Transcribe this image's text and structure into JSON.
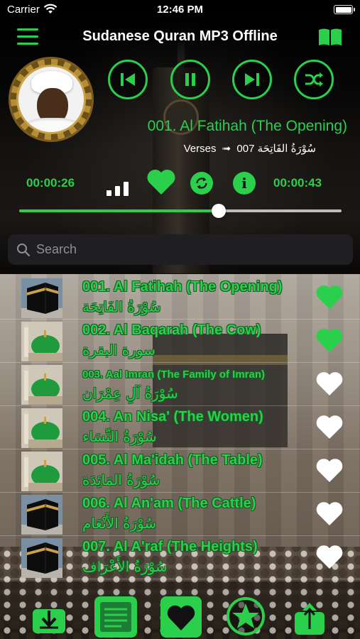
{
  "status_bar": {
    "carrier": "Carrier",
    "time": "12:46 PM"
  },
  "header": {
    "title": "Sudanese Quran MP3 Offline"
  },
  "player": {
    "track_title": "001. Al Fatihah (The Opening)",
    "verses_label": "Verses",
    "verses_count": "007",
    "arabic_name": "سُوْرَةُ الفَاتِحَة",
    "time_elapsed": "00:00:26",
    "time_total": "00:00:43",
    "progress": 0.62,
    "is_playing": true,
    "is_favorite": true
  },
  "search": {
    "placeholder": "Search"
  },
  "surahs": [
    {
      "en": "001. Al Fatihah (The Opening)",
      "ar": "سُوْرَةُ الفَاتِحَة",
      "thumb": "kaaba",
      "favorite": true
    },
    {
      "en": "002. Al Baqarah (The Cow)",
      "ar": "سورة البقرة",
      "thumb": "mosque",
      "favorite": true
    },
    {
      "en": "003. Aal Imran (The Family of Imran)",
      "ar": "سُوْرَةُ آلِ عِمْرَان",
      "thumb": "mosque",
      "favorite": false
    },
    {
      "en": "004. An Nisa' (The Women)",
      "ar": "سُوْرَةُ النِّسَاء",
      "thumb": "mosque",
      "favorite": false
    },
    {
      "en": "005. Al Ma'idah (The Table)",
      "ar": "سُوْرَةُ المَائِدَة",
      "thumb": "mosque",
      "favorite": false
    },
    {
      "en": "006. Al An'am (The Cattle)",
      "ar": "سُوْرَةُ الأَنْعَام",
      "thumb": "kaaba",
      "favorite": false
    },
    {
      "en": "007. Al A'raf (The Heights)",
      "ar": "سُوْرَةُ الأَعْرَاف",
      "thumb": "kaaba",
      "favorite": false
    }
  ],
  "colors": {
    "accent": "#2ad04c",
    "background": "#000000",
    "search_bg": "#1f1f21",
    "placeholder": "#8e8e93"
  },
  "tabs": [
    {
      "icon": "download-icon"
    },
    {
      "icon": "quran-book-icon"
    },
    {
      "icon": "favorites-heart-icon"
    },
    {
      "icon": "rate-star-icon"
    },
    {
      "icon": "share-icon"
    }
  ]
}
